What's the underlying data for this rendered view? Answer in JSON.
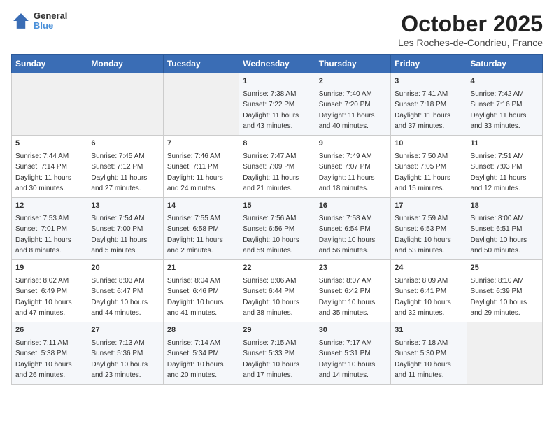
{
  "header": {
    "logo_line1": "General",
    "logo_line2": "Blue",
    "month": "October 2025",
    "location": "Les Roches-de-Condrieu, France"
  },
  "days_of_week": [
    "Sunday",
    "Monday",
    "Tuesday",
    "Wednesday",
    "Thursday",
    "Friday",
    "Saturday"
  ],
  "weeks": [
    [
      {
        "day": "",
        "info": ""
      },
      {
        "day": "",
        "info": ""
      },
      {
        "day": "",
        "info": ""
      },
      {
        "day": "1",
        "info": "Sunrise: 7:38 AM\nSunset: 7:22 PM\nDaylight: 11 hours and 43 minutes."
      },
      {
        "day": "2",
        "info": "Sunrise: 7:40 AM\nSunset: 7:20 PM\nDaylight: 11 hours and 40 minutes."
      },
      {
        "day": "3",
        "info": "Sunrise: 7:41 AM\nSunset: 7:18 PM\nDaylight: 11 hours and 37 minutes."
      },
      {
        "day": "4",
        "info": "Sunrise: 7:42 AM\nSunset: 7:16 PM\nDaylight: 11 hours and 33 minutes."
      }
    ],
    [
      {
        "day": "5",
        "info": "Sunrise: 7:44 AM\nSunset: 7:14 PM\nDaylight: 11 hours and 30 minutes."
      },
      {
        "day": "6",
        "info": "Sunrise: 7:45 AM\nSunset: 7:12 PM\nDaylight: 11 hours and 27 minutes."
      },
      {
        "day": "7",
        "info": "Sunrise: 7:46 AM\nSunset: 7:11 PM\nDaylight: 11 hours and 24 minutes."
      },
      {
        "day": "8",
        "info": "Sunrise: 7:47 AM\nSunset: 7:09 PM\nDaylight: 11 hours and 21 minutes."
      },
      {
        "day": "9",
        "info": "Sunrise: 7:49 AM\nSunset: 7:07 PM\nDaylight: 11 hours and 18 minutes."
      },
      {
        "day": "10",
        "info": "Sunrise: 7:50 AM\nSunset: 7:05 PM\nDaylight: 11 hours and 15 minutes."
      },
      {
        "day": "11",
        "info": "Sunrise: 7:51 AM\nSunset: 7:03 PM\nDaylight: 11 hours and 12 minutes."
      }
    ],
    [
      {
        "day": "12",
        "info": "Sunrise: 7:53 AM\nSunset: 7:01 PM\nDaylight: 11 hours and 8 minutes."
      },
      {
        "day": "13",
        "info": "Sunrise: 7:54 AM\nSunset: 7:00 PM\nDaylight: 11 hours and 5 minutes."
      },
      {
        "day": "14",
        "info": "Sunrise: 7:55 AM\nSunset: 6:58 PM\nDaylight: 11 hours and 2 minutes."
      },
      {
        "day": "15",
        "info": "Sunrise: 7:56 AM\nSunset: 6:56 PM\nDaylight: 10 hours and 59 minutes."
      },
      {
        "day": "16",
        "info": "Sunrise: 7:58 AM\nSunset: 6:54 PM\nDaylight: 10 hours and 56 minutes."
      },
      {
        "day": "17",
        "info": "Sunrise: 7:59 AM\nSunset: 6:53 PM\nDaylight: 10 hours and 53 minutes."
      },
      {
        "day": "18",
        "info": "Sunrise: 8:00 AM\nSunset: 6:51 PM\nDaylight: 10 hours and 50 minutes."
      }
    ],
    [
      {
        "day": "19",
        "info": "Sunrise: 8:02 AM\nSunset: 6:49 PM\nDaylight: 10 hours and 47 minutes."
      },
      {
        "day": "20",
        "info": "Sunrise: 8:03 AM\nSunset: 6:47 PM\nDaylight: 10 hours and 44 minutes."
      },
      {
        "day": "21",
        "info": "Sunrise: 8:04 AM\nSunset: 6:46 PM\nDaylight: 10 hours and 41 minutes."
      },
      {
        "day": "22",
        "info": "Sunrise: 8:06 AM\nSunset: 6:44 PM\nDaylight: 10 hours and 38 minutes."
      },
      {
        "day": "23",
        "info": "Sunrise: 8:07 AM\nSunset: 6:42 PM\nDaylight: 10 hours and 35 minutes."
      },
      {
        "day": "24",
        "info": "Sunrise: 8:09 AM\nSunset: 6:41 PM\nDaylight: 10 hours and 32 minutes."
      },
      {
        "day": "25",
        "info": "Sunrise: 8:10 AM\nSunset: 6:39 PM\nDaylight: 10 hours and 29 minutes."
      }
    ],
    [
      {
        "day": "26",
        "info": "Sunrise: 7:11 AM\nSunset: 5:38 PM\nDaylight: 10 hours and 26 minutes."
      },
      {
        "day": "27",
        "info": "Sunrise: 7:13 AM\nSunset: 5:36 PM\nDaylight: 10 hours and 23 minutes."
      },
      {
        "day": "28",
        "info": "Sunrise: 7:14 AM\nSunset: 5:34 PM\nDaylight: 10 hours and 20 minutes."
      },
      {
        "day": "29",
        "info": "Sunrise: 7:15 AM\nSunset: 5:33 PM\nDaylight: 10 hours and 17 minutes."
      },
      {
        "day": "30",
        "info": "Sunrise: 7:17 AM\nSunset: 5:31 PM\nDaylight: 10 hours and 14 minutes."
      },
      {
        "day": "31",
        "info": "Sunrise: 7:18 AM\nSunset: 5:30 PM\nDaylight: 10 hours and 11 minutes."
      },
      {
        "day": "",
        "info": ""
      }
    ]
  ]
}
